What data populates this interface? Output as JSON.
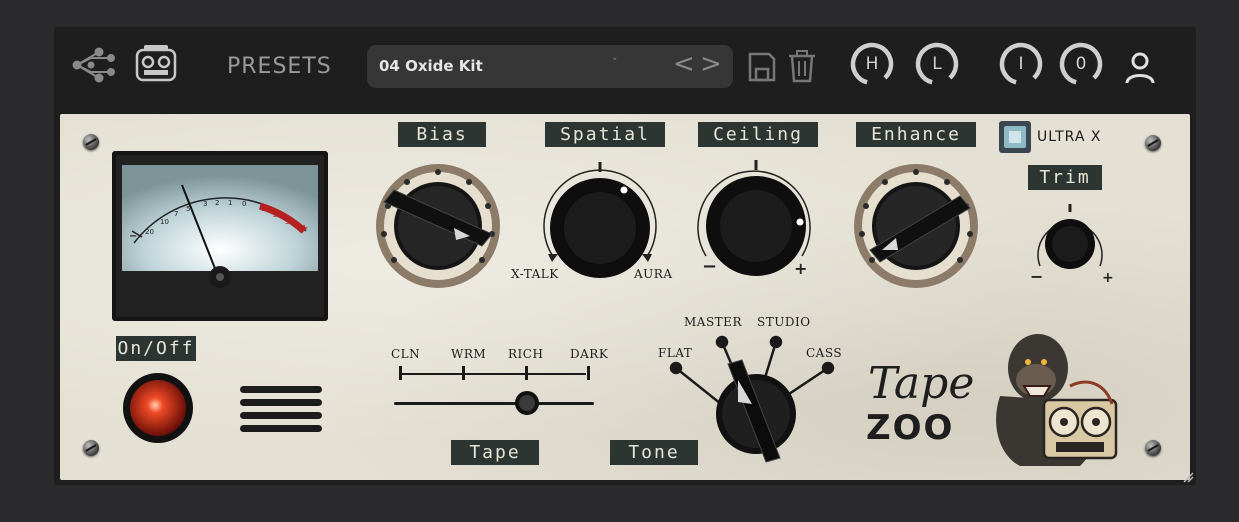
{
  "topbar": {
    "presets_label": "PRESETS",
    "preset_name": "04 Oxide Kit",
    "preset_caret": "˅",
    "prev_arrow": "<",
    "next_arrow": ">",
    "buttons": {
      "h": "H",
      "l": "L",
      "i": "I",
      "o": "0"
    }
  },
  "panel": {
    "knobs": {
      "bias": "Bias",
      "spatial": "Spatial",
      "ceiling": "Ceiling",
      "enhance": "Enhance",
      "trim": "Trim"
    },
    "spatial_left": "X-TALK",
    "spatial_right": "AURA",
    "ultra_x": "ULTRA X",
    "on_off": "On/Off",
    "tape": {
      "label": "Tape",
      "options": [
        "CLN",
        "WRM",
        "RICH",
        "DARK"
      ],
      "selected": "RICH"
    },
    "tone": {
      "label": "Tone",
      "options": [
        "FLAT",
        "MASTER",
        "STUDIO",
        "CASS"
      ],
      "selected": "MASTER"
    },
    "vu_scale": [
      "20",
      "10",
      "7",
      "5",
      "3",
      "2",
      "1",
      "0",
      "1",
      "2",
      "3"
    ],
    "brand_line1": "Tape",
    "brand_line2": "ZOO"
  },
  "colors": {
    "panel": "#e4e0d3",
    "tag_bg": "#2d3532",
    "led_red": "#e3321c",
    "vu_red": "#b52020",
    "ultra_led": "#8fb9c4"
  }
}
